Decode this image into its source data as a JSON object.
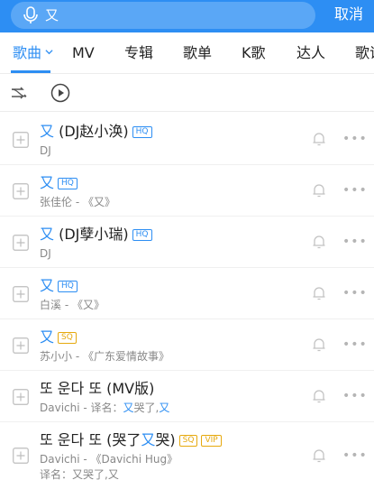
{
  "search": {
    "query": "又",
    "cancel_label": "取消"
  },
  "tabs": [
    {
      "label": "歌曲",
      "active": true
    },
    {
      "label": "MV"
    },
    {
      "label": "专辑"
    },
    {
      "label": "歌单"
    },
    {
      "label": "K歌"
    },
    {
      "label": "达人"
    },
    {
      "label": "歌词"
    }
  ],
  "songs": [
    {
      "title_hl": "又",
      "title_rest": " (DJ赵小涣)",
      "badges": [
        "HQ"
      ],
      "sub": "DJ"
    },
    {
      "title_hl": "又",
      "title_rest": "",
      "badges": [
        "HQ"
      ],
      "sub": "张佳伦 - 《又》"
    },
    {
      "title_hl": "又",
      "title_rest": " (DJ孽小瑞)",
      "badges": [
        "HQ"
      ],
      "sub": "DJ"
    },
    {
      "title_hl": "又",
      "title_rest": "",
      "badges": [
        "HQ"
      ],
      "sub": "白溪 - 《又》"
    },
    {
      "title_hl": "又",
      "title_rest": "",
      "badges": [
        "SQ"
      ],
      "sub": "苏小小 - 《广东爱情故事》"
    },
    {
      "title_plain": "또 운다 또 (MV版)",
      "sub_pre": "Davichi - 译名：",
      "sub_hl": "又",
      "sub_mid": "哭了,",
      "sub_hl2": "又"
    },
    {
      "title_pre": "또 운다 또 (哭了",
      "title_hl": "又",
      "title_post": "哭)",
      "badges": [
        "SQ",
        "VIP"
      ],
      "sub": "Davichi - 《Davichi Hug》",
      "sub2": "译名：又哭了,又"
    }
  ],
  "colors": {
    "accent": "#2d8ef3",
    "badge_gold": "#e6a90e"
  }
}
